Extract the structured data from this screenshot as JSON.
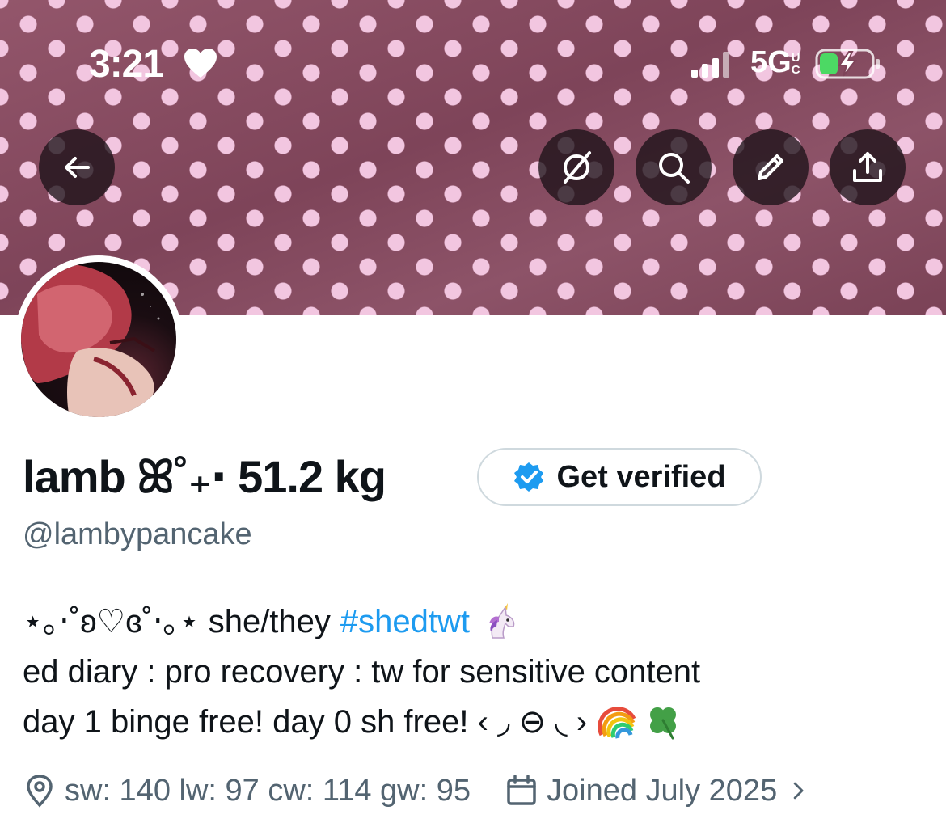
{
  "status_bar": {
    "time": "3:21",
    "network": "5G",
    "network_badge": "UC",
    "battery_charging": true
  },
  "header": {
    "banner_pattern": "polka-dot",
    "banner_color": "#8a4f64",
    "dot_color": "#f2c6e0",
    "buttons": [
      {
        "name": "back-button",
        "icon": "arrow-left-icon"
      },
      {
        "name": "grok-button",
        "icon": "grok-icon"
      },
      {
        "name": "search-button",
        "icon": "search-icon"
      },
      {
        "name": "edit-button",
        "icon": "pencil-icon"
      },
      {
        "name": "share-button",
        "icon": "share-icon"
      }
    ]
  },
  "profile": {
    "display_name": "lamb ꕤ˚₊‧ 51.2 kg",
    "handle": "@lambypancake",
    "verify_label": "Get verified",
    "verify_icon_color": "#1d9bf0",
    "bio": {
      "line1_text": "⋆｡‧˚ʚ♡ɞ˚‧｡⋆ she/they",
      "line1_hashtag": "#shedtwt",
      "line2": "ed diary : pro recovery : tw for sensitive content",
      "line3": "day 1 binge free! day 0 sh free! ‹ ◞ ⊖ ◟ › ",
      "emojis": [
        "unicorn-icon",
        "rainbow-icon",
        "four-leaf-clover-icon"
      ]
    },
    "location": "sw: 140 lw: 97 cw: 114 gw: 95",
    "joined": "Joined July 2025"
  },
  "colors": {
    "link": "#1d9bf0",
    "secondary_text": "#536471",
    "primary_text": "#0f1419"
  }
}
